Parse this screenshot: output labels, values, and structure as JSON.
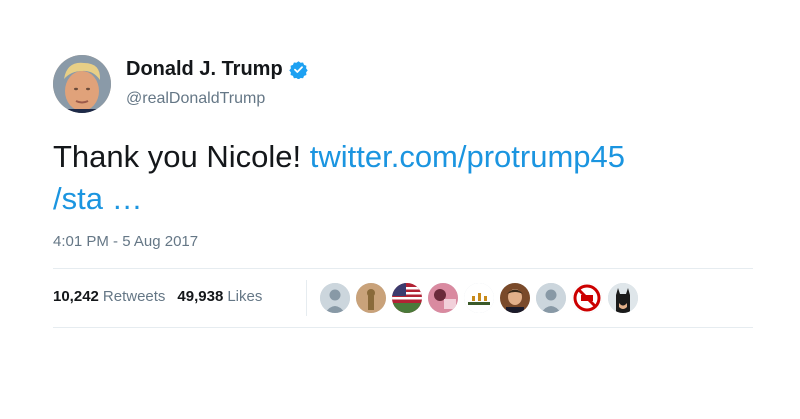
{
  "author": {
    "display_name": "Donald J. Trump",
    "handle": "@realDonaldTrump",
    "verified_icon": "verified-badge-icon",
    "verified_color": "#1da1f2"
  },
  "tweet": {
    "text": "Thank you Nicole! ",
    "link_line1": "twitter.com/protrump45",
    "link_line2": "/sta …",
    "link_color": "#1b95e0",
    "timestamp": "4:01 PM - 5 Aug 2017"
  },
  "stats": {
    "retweets_count": "10,242",
    "retweets_label": "Retweets",
    "likes_count": "49,938",
    "likes_label": "Likes"
  },
  "likers": [
    {
      "icon": "default-avatar-icon"
    },
    {
      "icon": "bronze-figure-avatar-icon"
    },
    {
      "icon": "american-flag-avatar-icon"
    },
    {
      "icon": "pink-scene-avatar-icon"
    },
    {
      "icon": "dlc-logo-avatar-icon"
    },
    {
      "icon": "portrait-avatar-icon"
    },
    {
      "icon": "default-avatar-icon"
    },
    {
      "icon": "no-cnn-avatar-icon"
    },
    {
      "icon": "batman-avatar-icon"
    }
  ]
}
